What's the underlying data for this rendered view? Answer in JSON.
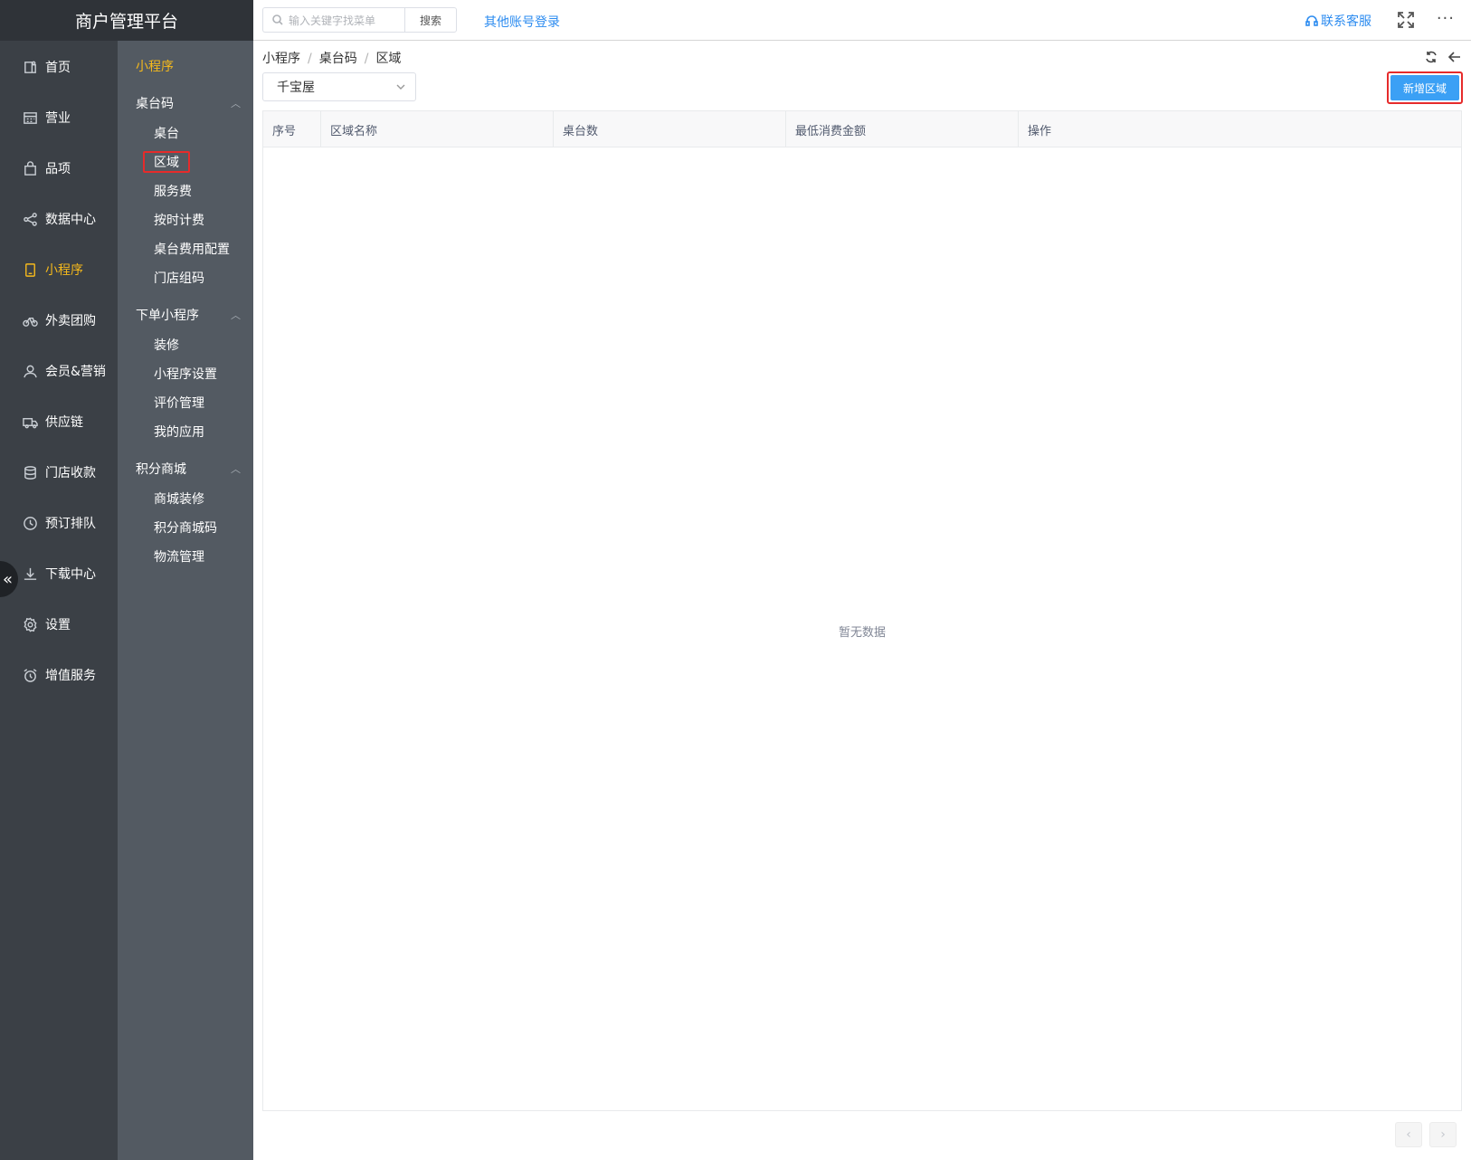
{
  "app": {
    "title": "商户管理平台"
  },
  "header": {
    "search_placeholder": "输入关键字找菜单",
    "search_button": "搜索",
    "other_login": "其他账号登录",
    "support": "联系客服",
    "more": "···"
  },
  "main_nav": [
    {
      "label": "首页",
      "icon": "home-icon"
    },
    {
      "label": "营业",
      "icon": "calendar-icon"
    },
    {
      "label": "品项",
      "icon": "bag-icon"
    },
    {
      "label": "数据中心",
      "icon": "share-icon"
    },
    {
      "label": "小程序",
      "icon": "tablet-icon",
      "active": true
    },
    {
      "label": "外卖团购",
      "icon": "bike-icon"
    },
    {
      "label": "会员&营销",
      "icon": "user-icon"
    },
    {
      "label": "供应链",
      "icon": "truck-icon"
    },
    {
      "label": "门店收款",
      "icon": "coins-icon"
    },
    {
      "label": "预订排队",
      "icon": "clock-icon"
    },
    {
      "label": "下载中心",
      "icon": "download-icon"
    },
    {
      "label": "设置",
      "icon": "gear-icon"
    },
    {
      "label": "增值服务",
      "icon": "alarm-icon"
    }
  ],
  "sub_nav": {
    "title": "小程序",
    "groups": [
      {
        "label": "桌台码",
        "items": [
          "桌台",
          "区域",
          "服务费",
          "按时计费",
          "桌台费用配置",
          "门店组码"
        ]
      },
      {
        "label": "下单小程序",
        "items": [
          "装修",
          "小程序设置",
          "评价管理",
          "我的应用"
        ]
      },
      {
        "label": "积分商城",
        "items": [
          "商城装修",
          "积分商城码",
          "物流管理"
        ]
      }
    ]
  },
  "breadcrumb": [
    "小程序",
    "桌台码",
    "区域"
  ],
  "filter": {
    "store_value": "千宝屋"
  },
  "actions": {
    "add_area": "新增区域"
  },
  "table": {
    "columns": [
      "序号",
      "区域名称",
      "桌台数",
      "最低消费金额",
      "操作"
    ],
    "empty_text": "暂无数据"
  },
  "pager": {
    "prev": "‹",
    "next": "›"
  },
  "colors": {
    "accent": "#f5b91c",
    "primary": "#3ba0f5",
    "highlight": "#e62b2b",
    "sidebar": "#3b4046",
    "subsidebar": "#535a62"
  }
}
